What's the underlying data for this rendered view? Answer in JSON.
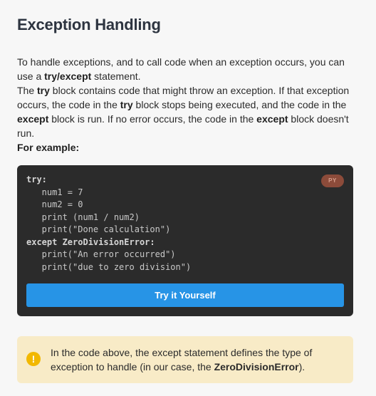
{
  "heading": "Exception Handling",
  "intro": {
    "p1": {
      "before": "To handle exceptions, and to call code when an exception occurs, you can use a ",
      "bold": "try/except",
      "after": " statement."
    },
    "p2": {
      "t1": "The ",
      "b1": "try",
      "t2": " block contains code that might throw an exception. If that exception occurs, the code in the ",
      "b2": "try",
      "t3": " block stops being executed, and the code in the ",
      "b3": "except",
      "t4": " block is run. If no error occurs, the code in the ",
      "b4": "except",
      "t5": " block doesn't run."
    },
    "for_example": "For example:"
  },
  "code_block": {
    "language_badge": "PY",
    "lines": {
      "l1": "try:",
      "l2": "   num1 = 7",
      "l3": "   num2 = 0",
      "l4": "   print (num1 / num2)",
      "l5": "   print(\"Done calculation\")",
      "l6": "except ZeroDivisionError:",
      "l7": "   print(\"An error occurred\")",
      "l8": "   print(\"due to zero division\")"
    },
    "try_button_label": "Try it Yourself"
  },
  "note": {
    "icon": "exclamation-icon",
    "icon_glyph": "!",
    "before": "In the code above, the except statement defines the type of exception to handle (in our case, the ",
    "bold": "ZeroDivisionError",
    "after": ")."
  },
  "colors": {
    "page_background": "#f7f7f7",
    "code_background": "#2b2b2b",
    "button_blue": "#2794e6",
    "badge_background": "#8c4b3a",
    "note_background": "#f8ebc7",
    "note_icon": "#f2b800"
  }
}
